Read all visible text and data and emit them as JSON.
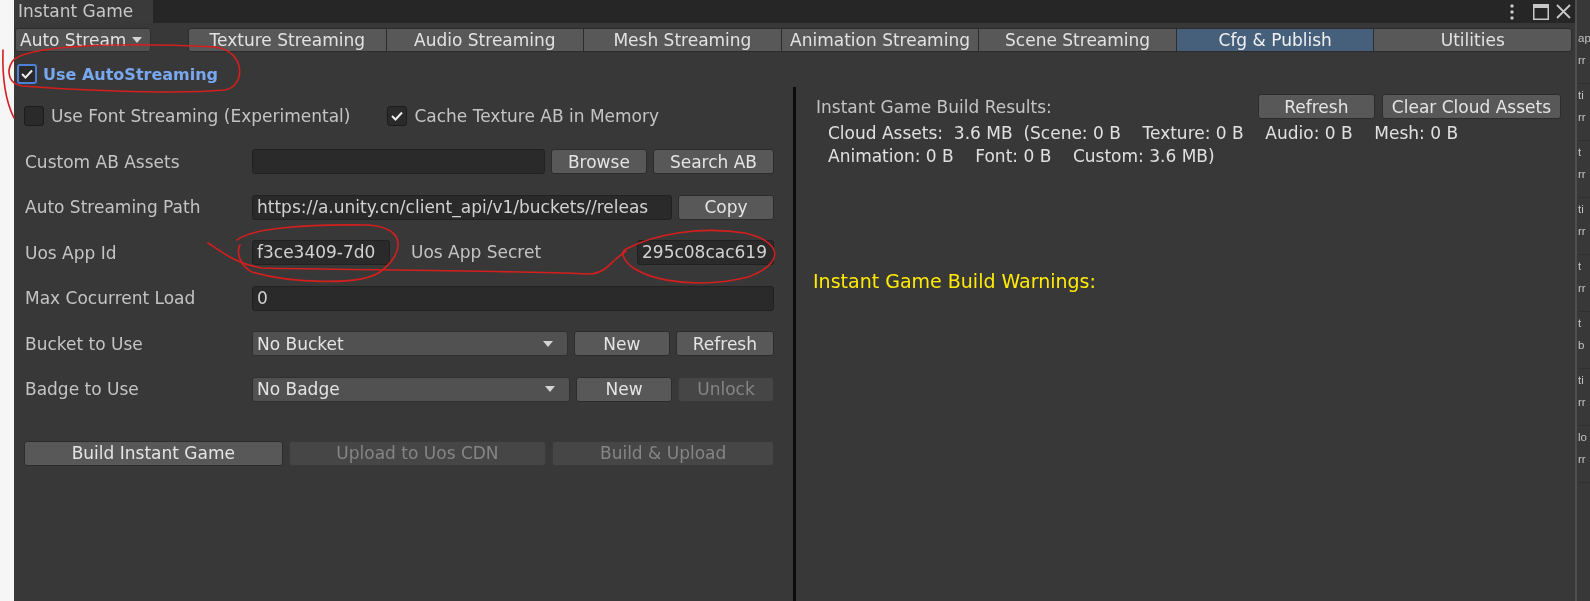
{
  "window": {
    "title": "Instant Game"
  },
  "mode_dropdown": {
    "value": "Auto Stream"
  },
  "tabs": [
    {
      "label": "Texture Streaming",
      "selected": false
    },
    {
      "label": "Audio Streaming",
      "selected": false
    },
    {
      "label": "Mesh Streaming",
      "selected": false
    },
    {
      "label": "Animation Streaming",
      "selected": false
    },
    {
      "label": "Scene Streaming",
      "selected": false
    },
    {
      "label": "Cfg & Publish",
      "selected": true
    },
    {
      "label": "Utilities",
      "selected": false
    }
  ],
  "use_autostreaming": {
    "label": "Use AutoStreaming",
    "checked": true
  },
  "options": [
    {
      "label": "Use Font Streaming (Experimental)",
      "checked": false
    },
    {
      "label": "Cache Texture AB in Memory",
      "checked": true
    }
  ],
  "form_rows": [
    {
      "kind": "field",
      "label": "Custom AB Assets",
      "buttons": [
        {
          "label": "Browse",
          "disabled": false
        },
        {
          "label": "Search AB",
          "disabled": false
        }
      ]
    },
    {
      "kind": "field",
      "label": "Auto Streaming Path",
      "value": "https://a.unity.cn/client_api/v1/buckets//releas",
      "buttons": [
        {
          "label": "Copy",
          "disabled": false
        }
      ]
    },
    {
      "kind": "pair",
      "label": "Uos App Id",
      "value": "f3ce3409-7d0",
      "second_label": "Uos App Secret",
      "second_value": "295c08cac619"
    },
    {
      "kind": "field",
      "label": "Max Cocurrent Load",
      "value": "0"
    },
    {
      "kind": "dropdown",
      "label": "Bucket to Use",
      "value": "No Bucket",
      "buttons": [
        {
          "label": "New",
          "disabled": false
        },
        {
          "label": "Refresh",
          "disabled": false
        }
      ]
    },
    {
      "kind": "dropdown",
      "label": "Badge to Use",
      "value": "No Badge",
      "buttons": [
        {
          "label": "New",
          "disabled": false
        },
        {
          "label": "Unlock",
          "disabled": true
        }
      ]
    }
  ],
  "actions": [
    {
      "label": "Build Instant Game",
      "disabled": false
    },
    {
      "label": "Upload to Uos CDN",
      "disabled": true
    },
    {
      "label": "Build & Upload",
      "disabled": true
    }
  ],
  "results": {
    "title": "Instant Game Build Results:",
    "buttons": [
      {
        "label": "Refresh",
        "disabled": false
      },
      {
        "label": "Clear Cloud Assets",
        "disabled": false
      }
    ],
    "summary": [
      "Cloud Assets:  3.6 MB  (Scene: 0 B    Texture: 0 B    Audio: 0 B    Mesh: 0 B",
      "Animation: 0 B    Font: 0 B    Custom: 3.6 MB)"
    ]
  },
  "warnings": {
    "title": "Instant Game Build Warnings:"
  },
  "side_panel": {
    "items": [
      {
        "lines": [
          "ap",
          "rr"
        ]
      },
      {
        "lines": [
          "ti",
          "rr"
        ]
      },
      {
        "lines": [
          "t",
          "rr"
        ]
      },
      {
        "lines": [
          "ti",
          "rr"
        ]
      },
      {
        "lines": [
          "t",
          "rr"
        ]
      },
      {
        "lines": [
          "t",
          "b"
        ]
      },
      {
        "lines": [
          "ti",
          "rr"
        ]
      },
      {
        "lines": [
          "lo",
          "rr"
        ]
      }
    ]
  }
}
